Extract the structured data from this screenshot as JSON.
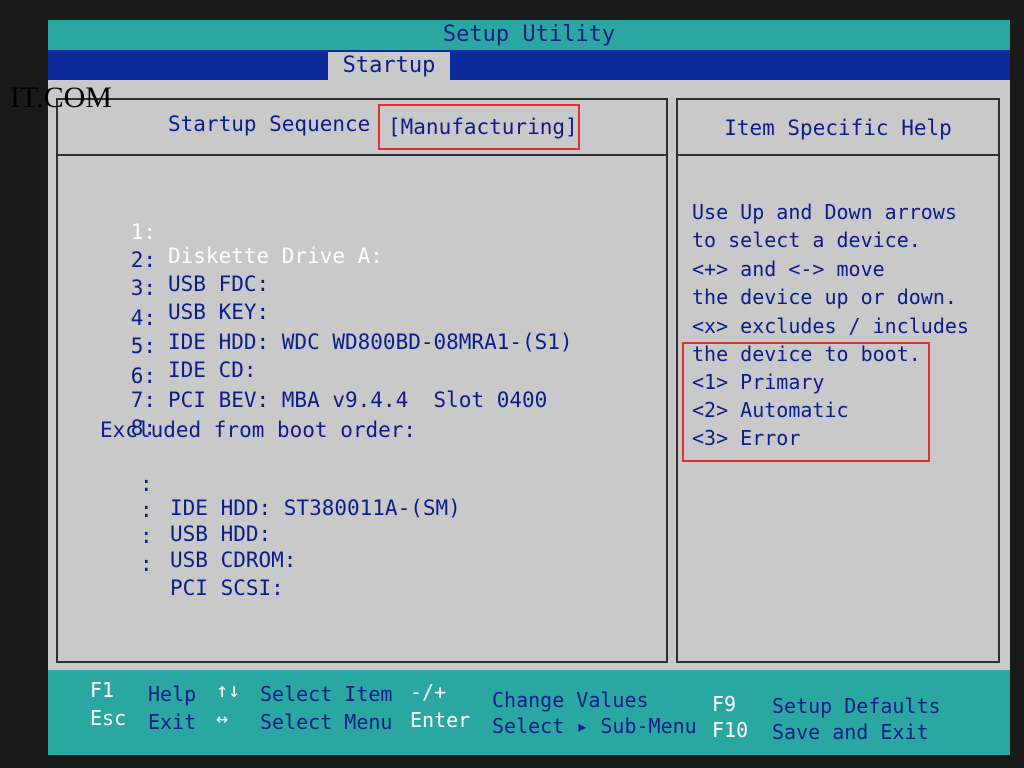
{
  "window": {
    "title": "Setup Utility",
    "active_tab": "Startup"
  },
  "watermark": "IT.COM",
  "startup_sequence": {
    "label": "Startup Sequence",
    "value": "[Manufacturing]"
  },
  "boot_order": [
    {
      "num": "1:",
      "device": "Diskette Drive A:"
    },
    {
      "num": "2:",
      "device": "USB FDC:"
    },
    {
      "num": "3:",
      "device": "USB KEY:"
    },
    {
      "num": "4:",
      "device": "IDE HDD: WDC WD800BD-08MRA1-(S1)"
    },
    {
      "num": "5:",
      "device": "IDE CD:"
    },
    {
      "num": "6:",
      "device": "PCI BEV: MBA v9.4.4  Slot 0400"
    },
    {
      "num": "7:",
      "device": ""
    },
    {
      "num": "8:",
      "device": ""
    }
  ],
  "excluded": {
    "title": "Excluded from boot order:",
    "items": [
      {
        "device": "IDE HDD: ST380011A-(SM)"
      },
      {
        "device": "USB HDD:"
      },
      {
        "device": "USB CDROM:"
      },
      {
        "device": "PCI SCSI:"
      }
    ]
  },
  "help": {
    "title": "Item Specific Help",
    "lines": [
      "Use Up and Down arrows",
      "to select a device.",
      "<+> and <-> move",
      "the device up or down.",
      "<x> excludes / includes",
      "the device to boot.",
      "<1> Primary",
      "<2> Automatic",
      "<3> Error"
    ]
  },
  "footer": {
    "f1": {
      "key": "F1",
      "label": "Help"
    },
    "esc": {
      "key": "Esc",
      "label": "Exit"
    },
    "updown": {
      "key": "↑↓",
      "label": "Select Item"
    },
    "leftright": {
      "key": "↔",
      "label": "Select Menu"
    },
    "minusplus": {
      "key": "-/+",
      "label": "Change Values"
    },
    "enter": {
      "key": "Enter",
      "label": "Select ▸ Sub-Menu"
    },
    "f9": {
      "key": "F9",
      "label": "Setup Defaults"
    },
    "f10": {
      "key": "F10",
      "label": "Save and Exit"
    }
  },
  "colors": {
    "background": "#c9c9c9",
    "title_bar": "#2aa7a0",
    "tab_bar": "#0c2a9a",
    "text": "#0a1d8a",
    "highlight_box": "#e03030"
  }
}
